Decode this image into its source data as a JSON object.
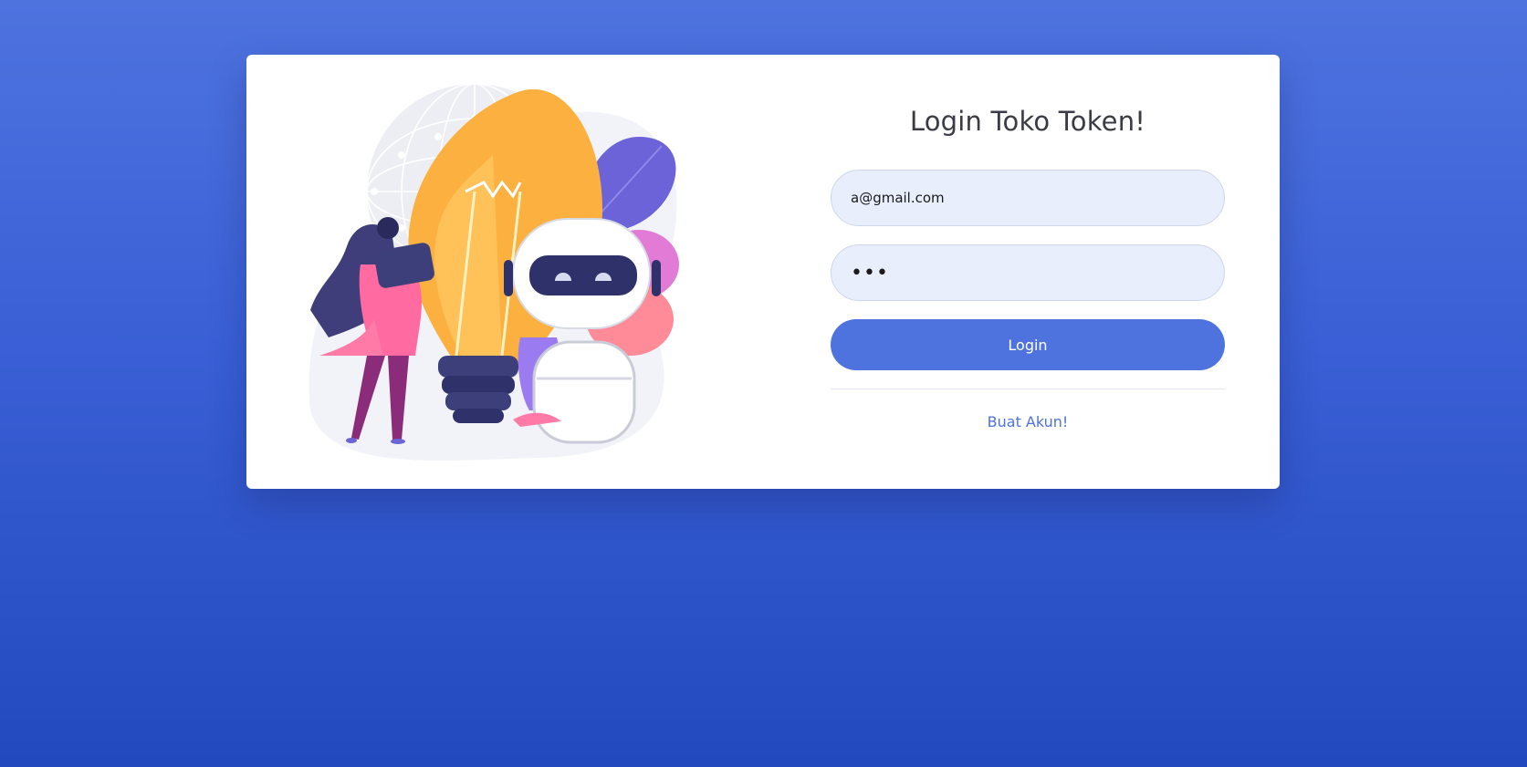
{
  "login": {
    "title": "Login Toko Token!",
    "email_value": "a@gmail.com",
    "password_value": "abc",
    "login_button": "Login",
    "register_link": "Buat Akun!"
  },
  "colors": {
    "background_top": "#4e73df",
    "background_bottom": "#224abe",
    "accent": "#4e73df",
    "input_background": "#e8eefc"
  },
  "illustration": {
    "icon": "robot-lightbulb-illustration"
  }
}
